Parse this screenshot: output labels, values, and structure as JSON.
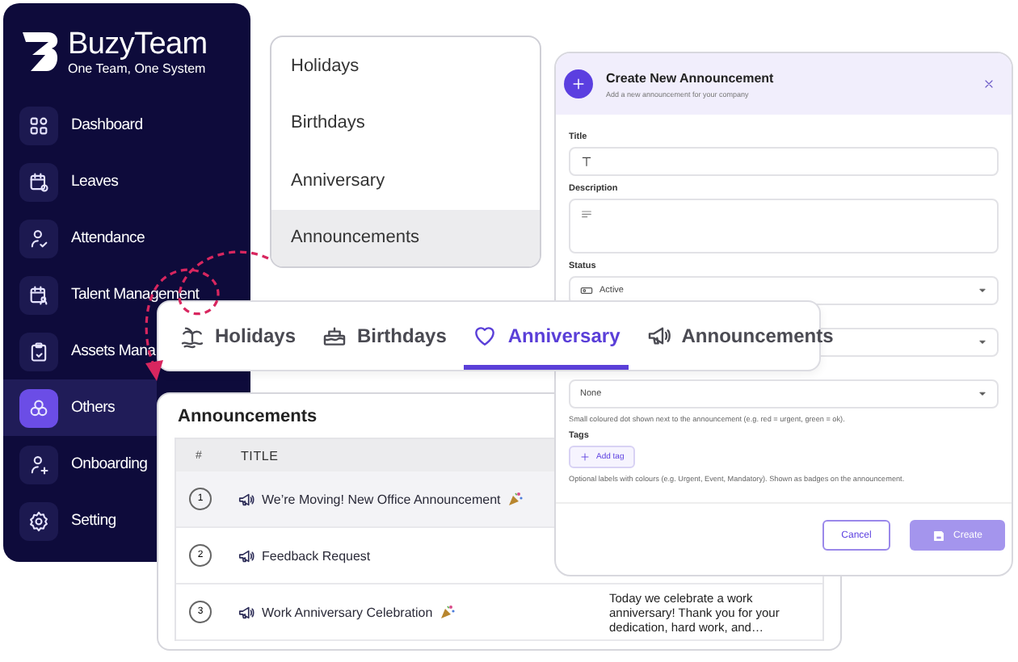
{
  "sidebar": {
    "logo": {
      "brand": "**Buzy**Team",
      "tagline": "One Team, One System"
    },
    "items": [
      {
        "label": "Dashboard",
        "kind": "grid",
        "selected": false
      },
      {
        "label": "Leaves",
        "kind": "calendar",
        "selected": false
      },
      {
        "label": "Attendance",
        "kind": "person-check",
        "selected": false
      },
      {
        "label": "Talent Management",
        "kind": "calendar-person",
        "selected": false
      },
      {
        "label": "Assets Mana",
        "kind": "clipboard",
        "selected": false
      },
      {
        "label": "Others",
        "kind": "circles",
        "selected": true
      },
      {
        "label": "Onboarding",
        "kind": "person-plus",
        "selected": false
      },
      {
        "label": "Setting",
        "kind": "gear",
        "selected": false
      }
    ]
  },
  "menu": {
    "items": [
      {
        "label": "Holidays",
        "selected": false
      },
      {
        "label": "Birthdays",
        "selected": false
      },
      {
        "label": "Anniversary",
        "selected": false
      },
      {
        "label": "Announcements",
        "selected": true
      }
    ]
  },
  "tabs": {
    "items": [
      {
        "label": "Holidays",
        "kind": "beach",
        "selected": false
      },
      {
        "label": "Birthdays",
        "kind": "cake",
        "selected": false
      },
      {
        "label": "Anniversary",
        "kind": "heart",
        "selected": true
      },
      {
        "label": "Announcements",
        "kind": "megaphone",
        "selected": false
      }
    ]
  },
  "announcements": {
    "title": "Announcements",
    "columns": [
      "#",
      "TITLE"
    ],
    "rows": [
      {
        "number": "1",
        "title": "We’re Moving! New Office Announcement",
        "party": true,
        "highlighted": true
      },
      {
        "number": "2",
        "title": "Feedback Request",
        "party": false,
        "highlighted": false
      },
      {
        "number": "3",
        "title": "Work Anniversary Celebration",
        "party": true,
        "highlighted": false,
        "description": "Today we celebrate a work anniversary! Thank you for your dedication, hard work, and…"
      }
    ]
  },
  "dialog": {
    "title": "Create New Announcement",
    "subtitle": "Add a new announcement for your company",
    "fields": [
      {
        "kind": "text",
        "label": "Title"
      },
      {
        "kind": "textarea",
        "label": "Description"
      },
      {
        "kind": "select",
        "label": "Status",
        "value": "Active"
      },
      {
        "kind": "select"
      },
      {
        "kind": "select",
        "value": "None",
        "help": "Small coloured dot shown next to the announcement (e.g. red = urgent, green = ok)."
      },
      {
        "kind": "tags",
        "label": "Tags",
        "button": "Add tag",
        "help": "Optional labels with colours (e.g. Urgent, Event, Mandatory). Shown as badges on the announcement."
      }
    ],
    "buttons": [
      {
        "label": "Cancel",
        "kind": "secondary",
        "disabled": false
      },
      {
        "label": "Create",
        "kind": "primary",
        "disabled": true
      }
    ]
  }
}
